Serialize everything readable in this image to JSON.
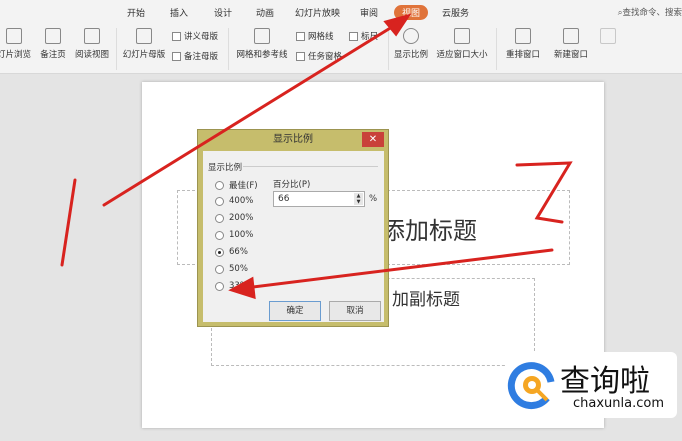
{
  "tabs": [
    "开始",
    "插入",
    "设计",
    "动画",
    "幻灯片放映",
    "审阅",
    "视图",
    "云服务"
  ],
  "active_tab": "视图",
  "search_placeholder": "查找命令、搜索",
  "ribbon": {
    "slide_browse": "灯片浏览",
    "notes_page": "备注页",
    "reading_view": "阅读视图",
    "slide_master": "幻灯片母版",
    "handout_master": "讲义母版",
    "notes_master": "备注母版",
    "grid_guides": "网格和参考线",
    "gridlines": "网格线",
    "ruler": "标尺",
    "task_pane": "任务窗格",
    "zoom": "显示比例",
    "fit_window": "适应窗口大小",
    "arrange_windows": "重排窗口",
    "new_window": "新建窗口"
  },
  "slide": {
    "title_visible": "添加标题",
    "subtitle_visible": "加副标题"
  },
  "dialog": {
    "title": "显示比例",
    "group": "显示比例",
    "percent_label": "百分比(P)",
    "percent_value": "66",
    "percent_unit": "%",
    "options": [
      "最佳(F)",
      "400%",
      "200%",
      "100%",
      "66%",
      "50%",
      "33%"
    ],
    "selected": "66%",
    "ok": "确定",
    "cancel": "取消"
  },
  "watermark": {
    "name": "查询啦",
    "url": "chaxunla.com"
  },
  "colors": {
    "accent": "#e0733a",
    "arrow": "#d8231f",
    "dialog_frame": "#c6bd6c"
  }
}
